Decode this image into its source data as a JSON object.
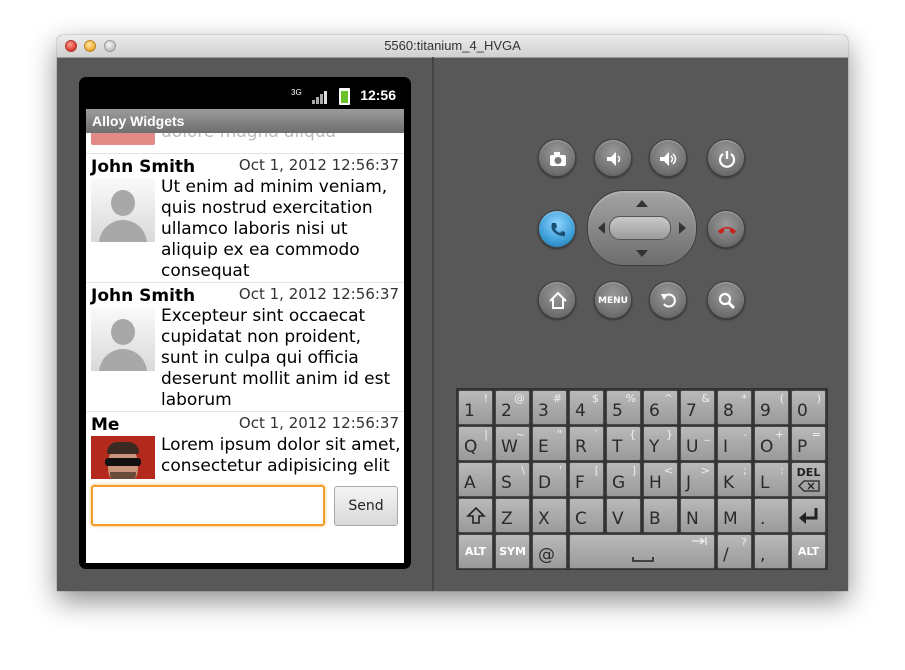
{
  "window": {
    "title": "5560:titanium_4_HVGA"
  },
  "status_bar": {
    "network": "3G",
    "time": "12:56"
  },
  "app": {
    "title": "Alloy Widgets"
  },
  "peek_text": "dolore magna aliqua",
  "messages": [
    {
      "name": "John Smith",
      "time": "Oct 1, 2012 12:56:37",
      "text": "Ut enim ad minim veniam, quis nostrud exercitation ullamco laboris nisi ut aliquip ex ea commodo consequat"
    },
    {
      "name": "John Smith",
      "time": "Oct 1, 2012 12:56:37",
      "text": "Excepteur sint occaecat cupidatat non proident, sunt in culpa qui officia deserunt mollit anim id est laborum"
    },
    {
      "name": "Me",
      "time": "Oct 1, 2012 12:56:37",
      "text": "Lorem ipsum dolor sit amet, consectetur adipisicing elit"
    }
  ],
  "composer": {
    "input_value": "",
    "send_label": "Send"
  },
  "emulator_buttons": {
    "menu_label": "MENU"
  },
  "keyboard": {
    "rows": [
      [
        {
          "m": "1",
          "a": "!"
        },
        {
          "m": "2",
          "a": "@"
        },
        {
          "m": "3",
          "a": "#"
        },
        {
          "m": "4",
          "a": "$"
        },
        {
          "m": "5",
          "a": "%"
        },
        {
          "m": "6",
          "a": "^"
        },
        {
          "m": "7",
          "a": "&"
        },
        {
          "m": "8",
          "a": "*"
        },
        {
          "m": "9",
          "a": "("
        },
        {
          "m": "0",
          "a": ")"
        }
      ],
      [
        {
          "m": "Q",
          "a": "|"
        },
        {
          "m": "W",
          "a": "~"
        },
        {
          "m": "E",
          "a": "\""
        },
        {
          "m": "R",
          "a": "`"
        },
        {
          "m": "T",
          "a": "{"
        },
        {
          "m": "Y",
          "a": "}"
        },
        {
          "m": "U",
          "a": "_"
        },
        {
          "m": "I",
          "a": "-"
        },
        {
          "m": "O",
          "a": "+"
        },
        {
          "m": "P",
          "a": "="
        }
      ],
      [
        {
          "m": "A",
          "a": ""
        },
        {
          "m": "S",
          "a": "\\"
        },
        {
          "m": "D",
          "a": "'"
        },
        {
          "m": "F",
          "a": "["
        },
        {
          "m": "G",
          "a": "]"
        },
        {
          "m": "H",
          "a": "<"
        },
        {
          "m": "J",
          "a": ">"
        },
        {
          "m": "K",
          "a": ";"
        },
        {
          "m": "L",
          "a": ":"
        }
      ],
      [
        {
          "m": "Z",
          "a": ""
        },
        {
          "m": "X",
          "a": ""
        },
        {
          "m": "C",
          "a": ""
        },
        {
          "m": "V",
          "a": ""
        },
        {
          "m": "B",
          "a": ""
        },
        {
          "m": "N",
          "a": ""
        },
        {
          "m": "M",
          "a": ""
        },
        {
          "m": ".",
          "a": ""
        }
      ],
      [
        {
          "m": "@",
          "a": ""
        },
        {
          "m": "/",
          "a": "?"
        },
        {
          "m": ",",
          "a": ""
        }
      ]
    ],
    "del_label": "DEL",
    "alt_label": "ALT",
    "sym_label": "SYM"
  }
}
